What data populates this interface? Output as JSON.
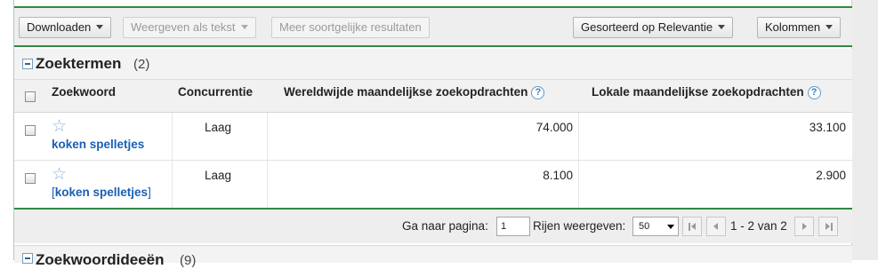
{
  "top_link": "",
  "toolbar": {
    "download_label": "Downloaden",
    "view_as_text_label": "Weergeven als tekst",
    "more_similar_label": "Meer soortgelijke resultaten",
    "sort_label": "Gesorteerd op Relevantie",
    "columns_label": "Kolommen"
  },
  "section": {
    "title": "Zoektermen",
    "count": "(2)"
  },
  "table": {
    "headers": {
      "keyword": "Zoekwoord",
      "competition": "Concurrentie",
      "global": "Wereldwijde maandelijkse zoekopdrachten",
      "local": "Lokale maandelijkse zoekopdrachten"
    },
    "help_glyph": "?",
    "rows": [
      {
        "star": "☆",
        "keyword": "koken spelletjes",
        "bracket_open": "",
        "bracket_close": "",
        "competition": "Laag",
        "global": "74.000",
        "local": "33.100"
      },
      {
        "star": "☆",
        "keyword": "koken spelletjes",
        "bracket_open": "[",
        "bracket_close": "]",
        "competition": "Laag",
        "global": "8.100",
        "local": "2.900"
      }
    ]
  },
  "pagination": {
    "goto_label": "Ga naar pagina:",
    "page_value": "1",
    "rows_label": "Rijen weergeven:",
    "rows_value": "50",
    "range_text": "1 - 2 van 2"
  },
  "next_section": {
    "title": "Zoekwoordideeën",
    "count": "(9)"
  },
  "colors": {
    "accent_green": "#2e8b3e",
    "link_blue": "#1a5fb4"
  }
}
